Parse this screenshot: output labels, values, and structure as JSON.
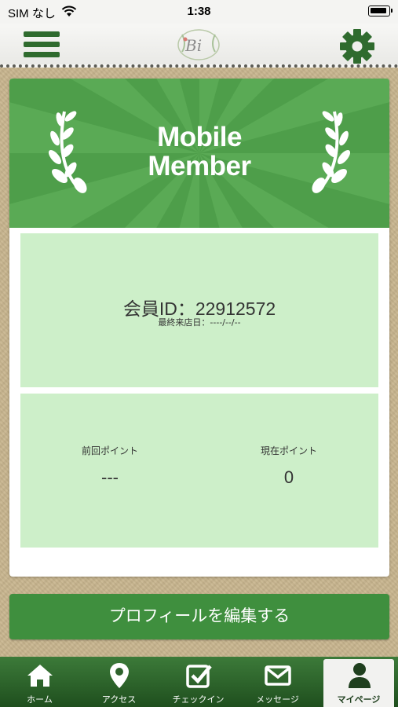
{
  "status_bar": {
    "carrier": "SIM なし",
    "time": "1:38"
  },
  "header": {
    "menu_icon": "hamburger-icon",
    "logo_text": "Bi",
    "settings_icon": "gear-icon"
  },
  "banner": {
    "title_line1": "Mobile",
    "title_line2": "Member"
  },
  "member": {
    "id_text": "会員ID：22912572",
    "last_visit": "最終来店日：----/--/--"
  },
  "points": {
    "previous_label": "前回ポイント",
    "previous_value": "---",
    "current_label": "現在ポイント",
    "current_value": "0"
  },
  "profile_button": "プロフィールを編集する",
  "tabs": [
    {
      "label": "ホーム",
      "icon": "home-icon"
    },
    {
      "label": "アクセス",
      "icon": "map-pin-icon"
    },
    {
      "label": "チェックイン",
      "icon": "checkbox-icon"
    },
    {
      "label": "メッセージ",
      "icon": "envelope-icon"
    },
    {
      "label": "マイページ",
      "icon": "user-icon",
      "active": true
    }
  ],
  "colors": {
    "primary_green": "#3f8f3e",
    "panel_green": "#cdefc9",
    "banner_green": "#4e9e4a"
  }
}
